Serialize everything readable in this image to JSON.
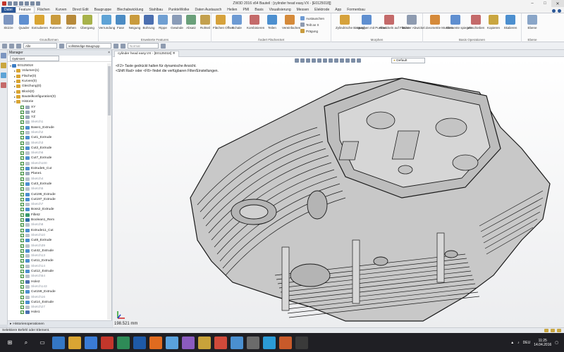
{
  "window": {
    "title": "ZW3D 2016  x64          Bauteil : [cylinder head easy.VX - [E0125018]]",
    "controls": [
      "–",
      "□",
      "✕"
    ]
  },
  "ribbon_tabs": [
    "Datei",
    "Feature",
    "Flächen",
    "Kurven",
    "Direct Edit",
    "Baugruppe",
    "Blechabwicklung",
    "Stahlbau",
    "PunkteWolke",
    "Daten Austausch",
    "Heilen",
    "PMI",
    "Basis",
    "Visualisierung",
    "Messen",
    "Elektrode",
    "App",
    "Formenbau"
  ],
  "ribbon": {
    "groups": [
      {
        "label": "Grundformen",
        "buttons": [
          "Skizze",
          "Quader",
          "Extrudieren",
          "Rotieren",
          "Ziehen",
          "Übergang"
        ]
      },
      {
        "label": "Erweiterte Features",
        "buttons": [
          "Verrundung",
          "Fase",
          "Neigung",
          "Bohrung",
          "Rippe",
          "Gewinde",
          "Absatz",
          "Rohteil"
        ]
      },
      {
        "label": "Ändert FlächenSet",
        "buttons": [
          "Flächen Offset",
          "Schale",
          "Kombinieren",
          "Teilen",
          "Vereinfachen"
        ]
      },
      {
        "label": "Morphen",
        "buttons": [
          "Zylindrische Biegung",
          "Morphen mit Punkten",
          "Abwickeln auf Fläche",
          "Muster Abwickel..."
        ]
      },
      {
        "label": "Basis Operationen",
        "buttons": [
          "Geometrie Mustern",
          "Elemente spiegeln",
          "Verschieben",
          "Kopieren",
          "Skalieren"
        ]
      },
      {
        "label": "Ebene",
        "buttons": [
          "Ebene"
        ]
      }
    ],
    "small_tools": [
      "Austauschen",
      "Teilt an X",
      "Prägung"
    ]
  },
  "toolbar": {
    "filter_value": "Alle",
    "mode_value": "vollständige Baugrupp",
    "render_value": "Normal"
  },
  "manager": {
    "title": "Manager",
    "selector": "Optimiert",
    "footer": "Historienoperationen",
    "tree": [
      {
        "label": "E0125018",
        "level": 0,
        "kind": "root"
      },
      {
        "label": "Volumen(1)",
        "level": 1,
        "kind": "folder"
      },
      {
        "label": "Fläche(0)",
        "level": 1,
        "kind": "folder"
      },
      {
        "label": "Kurven(0)",
        "level": 1,
        "kind": "folder"
      },
      {
        "label": "Gleichung(0)",
        "level": 1,
        "kind": "folder"
      },
      {
        "label": "Block(0)",
        "level": 1,
        "kind": "folder"
      },
      {
        "label": "Bauteilkonfiguration(0)",
        "level": 1,
        "kind": "folder"
      },
      {
        "label": "Historie",
        "level": 1,
        "kind": "folder"
      },
      {
        "label": "XY",
        "level": 2,
        "kind": "plane"
      },
      {
        "label": "XZ",
        "level": 2,
        "kind": "plane"
      },
      {
        "label": "YZ",
        "level": 2,
        "kind": "plane"
      },
      {
        "label": "Sketch1",
        "level": 2,
        "kind": "sketch"
      },
      {
        "label": "Base1_Extrude",
        "level": 2,
        "kind": "feature"
      },
      {
        "label": "Sketch2",
        "level": 2,
        "kind": "sketch"
      },
      {
        "label": "Cut1_Extrude",
        "level": 2,
        "kind": "feature"
      },
      {
        "label": "Sketch3",
        "level": 2,
        "kind": "sketch"
      },
      {
        "label": "Cut2_Extrude",
        "level": 2,
        "kind": "feature"
      },
      {
        "label": "Sketch6",
        "level": 2,
        "kind": "sketch"
      },
      {
        "label": "Cut7_Extrude",
        "level": 2,
        "kind": "feature"
      },
      {
        "label": "Sketch100",
        "level": 2,
        "kind": "sketch"
      },
      {
        "label": "Extrude5_Cut",
        "level": 2,
        "kind": "feature"
      },
      {
        "label": "Plane1",
        "level": 2,
        "kind": "plane"
      },
      {
        "label": "Sketch4",
        "level": 2,
        "kind": "sketch"
      },
      {
        "label": "Cut3_Extrude",
        "level": 2,
        "kind": "feature"
      },
      {
        "label": "Sketch5",
        "level": 2,
        "kind": "sketch"
      },
      {
        "label": "Cut196_Extrude",
        "level": 2,
        "kind": "feature"
      },
      {
        "label": "Cut197_Extrude",
        "level": 2,
        "kind": "feature"
      },
      {
        "label": "Sketch7",
        "level": 2,
        "kind": "sketch"
      },
      {
        "label": "Boss2_Extrude",
        "level": 2,
        "kind": "feature"
      },
      {
        "label": "Fillet2",
        "level": 2,
        "kind": "fillet"
      },
      {
        "label": "Boolean1_Rem",
        "level": 2,
        "kind": "boolean"
      },
      {
        "label": "Sketch8",
        "level": 2,
        "kind": "sketch"
      },
      {
        "label": "Extrude11_Cut",
        "level": 2,
        "kind": "feature"
      },
      {
        "label": "Sketch10",
        "level": 2,
        "kind": "sketch"
      },
      {
        "label": "Cut8_Extrude",
        "level": 2,
        "kind": "feature"
      },
      {
        "label": "Sketch39",
        "level": 2,
        "kind": "sketch"
      },
      {
        "label": "Cut42_Extrude",
        "level": 2,
        "kind": "feature"
      },
      {
        "label": "Sketch13",
        "level": 2,
        "kind": "sketch"
      },
      {
        "label": "Cut11_Extrude",
        "level": 2,
        "kind": "feature"
      },
      {
        "label": "Sketch14",
        "level": 2,
        "kind": "sketch"
      },
      {
        "label": "Cut12_Extrude",
        "level": 2,
        "kind": "feature"
      },
      {
        "label": "Sketch54",
        "level": 2,
        "kind": "sketch"
      },
      {
        "label": "Hole2",
        "level": 2,
        "kind": "hole"
      },
      {
        "label": "Sketch143",
        "level": 2,
        "kind": "sketch"
      },
      {
        "label": "Cut159_Extrude",
        "level": 2,
        "kind": "feature"
      },
      {
        "label": "Sketch16",
        "level": 2,
        "kind": "sketch"
      },
      {
        "label": "Cut14_Extrude",
        "level": 2,
        "kind": "feature"
      },
      {
        "label": "Sketch27",
        "level": 2,
        "kind": "sketch"
      },
      {
        "label": "Hole1",
        "level": 2,
        "kind": "hole"
      }
    ]
  },
  "document_tab": "cylinder head easy.VX - [E0125018]",
  "viewport": {
    "hint_line1": "<F2> Taste gedrückt halten für dynamische Ansicht.",
    "hint_line2": "<Shift Rad> oder <F8> findet die verfügbaren Filter/Einstellungen.",
    "view_style": "Default",
    "scale_readout": "198.521 mm"
  },
  "status": {
    "text": "Selektiere Befehl oder Element."
  },
  "taskbar": {
    "language": "DEU",
    "time": "11:25",
    "date": "14.04.2016"
  },
  "colors": {
    "accent": "#2b5797",
    "model_face": "#c8c8c8",
    "model_edge": "#1a1a1a",
    "check_green": "#3a8a3a"
  }
}
